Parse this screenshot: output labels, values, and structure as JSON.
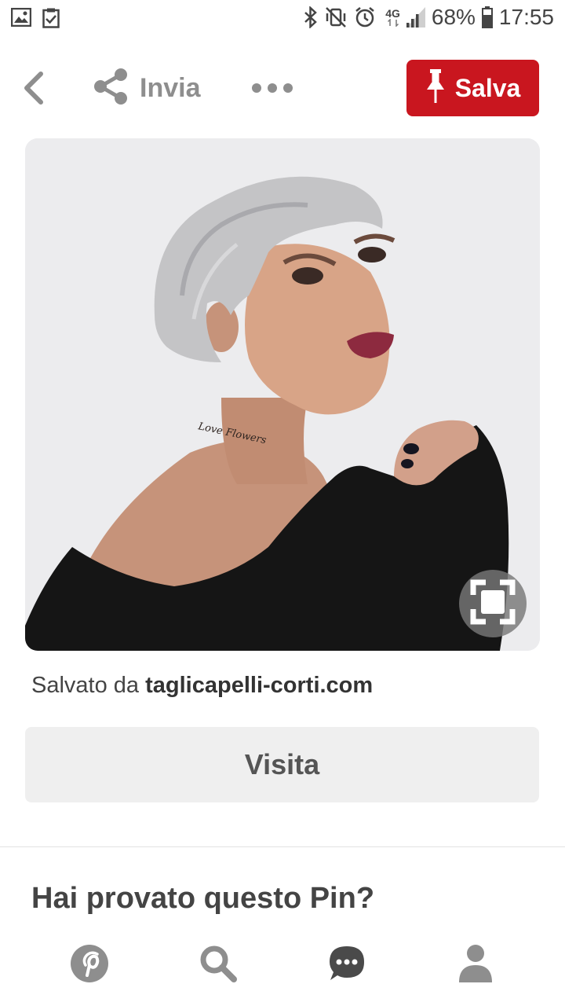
{
  "status_bar": {
    "battery": "68%",
    "time": "17:55",
    "network": "4G",
    "left_icons": [
      "gallery-icon",
      "clipboard-check-icon"
    ],
    "right_icons": [
      "bluetooth-icon",
      "vibrate-mute-icon",
      "alarm-icon",
      "signal-icon",
      "battery-icon"
    ]
  },
  "toolbar": {
    "back_icon": "chevron-left-icon",
    "share_label": "Invia",
    "share_icon": "share-icon",
    "more_icon": "more-dots-icon",
    "save_label": "Salva",
    "save_icon": "pin-icon",
    "save_color": "#c9161f"
  },
  "pin": {
    "image_description_icon": "photo",
    "lens_icon": "visual-search-icon",
    "saved_from_prefix": "Salvato da",
    "saved_from_domain": "taglicapelli-corti.com",
    "tattoo_text": "Love Flowers"
  },
  "visit_button": {
    "label": "Visita"
  },
  "section": {
    "title": "Hai provato questo Pin?"
  },
  "bottom_nav": {
    "items": [
      {
        "name": "home",
        "icon": "pinterest-logo-icon"
      },
      {
        "name": "search",
        "icon": "search-icon"
      },
      {
        "name": "messages",
        "icon": "chat-bubble-icon"
      },
      {
        "name": "profile",
        "icon": "profile-icon"
      }
    ],
    "icon_color": "#8e8e8e"
  }
}
